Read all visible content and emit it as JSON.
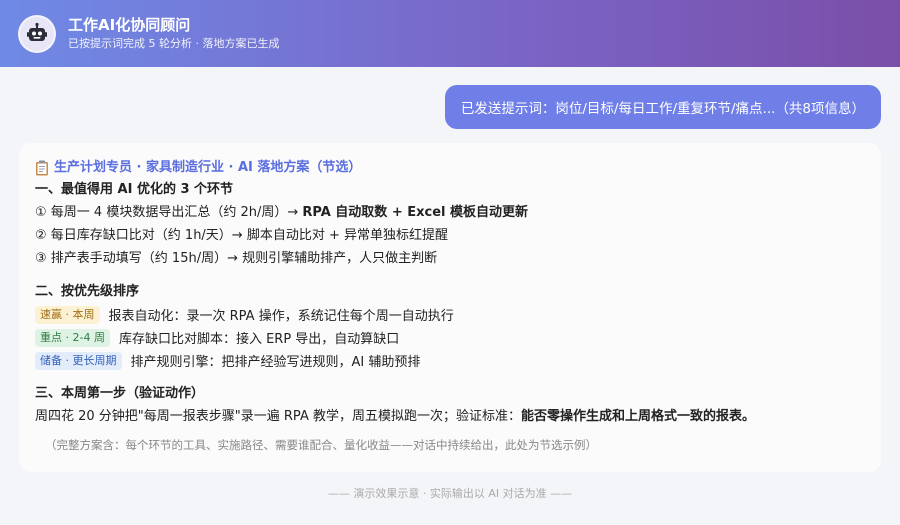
{
  "header": {
    "title": "工作AI化协同顾问",
    "subtitle": "已按提示词完成 5 轮分析 · 落地方案已生成",
    "avatar_icon": "robot-icon"
  },
  "user_message": "已发送提示词：岗位/目标/每日工作/重复环节/痛点...（共8项信息）",
  "card": {
    "title": "生产计划专员 · 家具制造行业 · AI 落地方案（节选）",
    "title_icon": "clipboard-icon",
    "section1": {
      "heading": "一、最值得用 AI 优化的 3 个环节",
      "items": [
        {
          "prefix": "① 每周一 4 模块数据导出汇总（约 2h/周）→ ",
          "bold": "RPA 自动取数 + Excel 模板自动更新"
        },
        {
          "prefix": "② 每日库存缺口比对（约 1h/天）→ 脚本自动比对 + 异常单独标红提醒",
          "bold": ""
        },
        {
          "prefix": "③ 排产表手动填写（约 15h/周）→ 规则引擎辅助排产，人只做主判断",
          "bold": ""
        }
      ]
    },
    "section2": {
      "heading": "二、按优先级排序",
      "items": [
        {
          "tag": "速赢 · 本周",
          "text": "报表自动化：录一次 RPA 操作，系统记住每个周一自动执行"
        },
        {
          "tag": "重点 · 2-4 周",
          "text": "库存缺口比对脚本：接入 ERP 导出，自动算缺口"
        },
        {
          "tag": "储备 · 更长周期",
          "text": "排产规则引擎：把排产经验写进规则，AI 辅助预排"
        }
      ]
    },
    "section3": {
      "heading": "三、本周第一步（验证动作）",
      "text": "周四花 20 分钟把\"每周一报表步骤\"录一遍 RPA 教学，周五模拟跑一次；验证标准：",
      "bold": "能否零操作生成和上周格式一致的报表。"
    },
    "note": "（完整方案含：每个环节的工具、实施路径、需要谁配合、量化收益——对话中持续给出，此处为节选示例）"
  },
  "footer": "—— 演示效果示意 · 实际输出以 AI 对话为准 ——",
  "colors": {
    "accent": "#6f7fe7",
    "title_blue": "#5b6ee0",
    "tag_yellow": "#fdf1d3",
    "tag_green": "#dff3e4",
    "tag_blue": "#e2ecfb"
  }
}
